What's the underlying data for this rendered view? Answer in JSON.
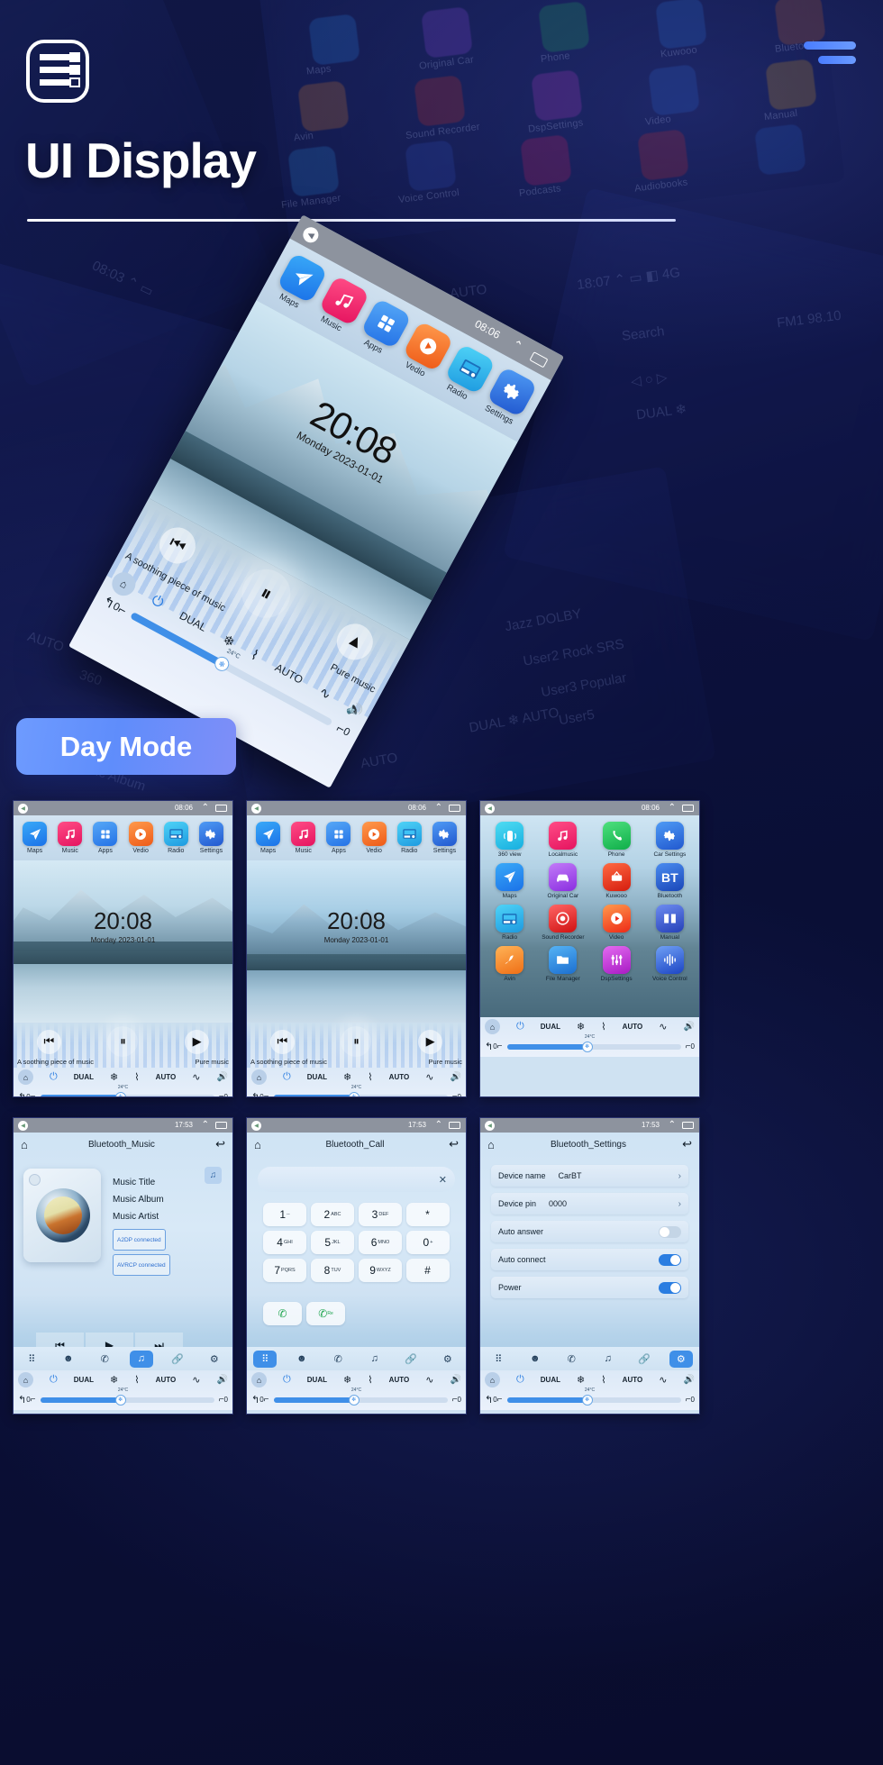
{
  "header": {
    "title": "UI Display",
    "logo_icon": "list-logo-icon",
    "menu_icon": "hamburger-menu-icon"
  },
  "badge": {
    "label": "Day Mode"
  },
  "hero": {
    "status": {
      "time": "08:06",
      "back_icon": "back-circle-icon",
      "chevron_icon": "chevron-up-icon",
      "window_icon": "recent-apps-icon"
    },
    "dock": [
      {
        "label": "Maps",
        "icon": "navigation-icon",
        "color": "#2b8cf5"
      },
      {
        "label": "Music",
        "icon": "music-note-icon",
        "color": "#f0316d"
      },
      {
        "label": "Apps",
        "icon": "grid-icon",
        "color": "#3b8ef0"
      },
      {
        "label": "Vedio",
        "icon": "play-icon",
        "color": "#f2702a"
      },
      {
        "label": "Radio",
        "icon": "radio-icon",
        "color": "#2fb3ef"
      },
      {
        "label": "Settings",
        "icon": "gear-icon",
        "color": "#2d7bea"
      }
    ],
    "clock": "20:08",
    "date": "Monday  2023-01-01",
    "media": {
      "song": "A soothing piece of music",
      "mode": "Pure music",
      "prev_icon": "prev-track-icon",
      "pause_icon": "pause-icon",
      "next_icon": "next-track-icon"
    },
    "climate": {
      "home_icon": "home-icon",
      "power_icon": "power-icon",
      "dual": "DUAL",
      "snow_icon": "snowflake-icon",
      "temp": "24°C",
      "defrost_icon": "rear-defrost-icon",
      "auto": "AUTO",
      "wave_icon": "airflow-icon",
      "volume_icon": "volume-icon",
      "back_icon": "back-arrow-icon",
      "left_value": "0",
      "right_value": "0",
      "seat_icon": "seat-icon",
      "fan_icon": "fan-icon"
    }
  },
  "thumbnails": [
    {
      "name": "home-winter-lake",
      "type": "home",
      "status": {
        "time": "08:06"
      },
      "dock": [
        {
          "label": "Maps",
          "icon": "navigation-icon",
          "color": "#2b8cf5"
        },
        {
          "label": "Music",
          "icon": "music-note-icon",
          "color": "#f0316d"
        },
        {
          "label": "Apps",
          "icon": "grid-icon",
          "color": "#3b8ef0"
        },
        {
          "label": "Vedio",
          "icon": "play-icon",
          "color": "#f2702a"
        },
        {
          "label": "Radio",
          "icon": "radio-icon",
          "color": "#2fb3ef"
        },
        {
          "label": "Settings",
          "icon": "gear-icon",
          "color": "#2d7bea"
        }
      ],
      "clock": "20:08",
      "date": "Monday  2023-01-01",
      "song": "A soothing piece of music",
      "mode": "Pure music"
    },
    {
      "name": "home-mountain-lake",
      "type": "home",
      "status": {
        "time": "08:06"
      },
      "dock": [
        {
          "label": "Maps",
          "icon": "navigation-icon",
          "color": "#2b8cf5"
        },
        {
          "label": "Music",
          "icon": "music-note-icon",
          "color": "#f0316d"
        },
        {
          "label": "Apps",
          "icon": "grid-icon",
          "color": "#3b8ef0"
        },
        {
          "label": "Vedio",
          "icon": "play-icon",
          "color": "#f2702a"
        },
        {
          "label": "Radio",
          "icon": "radio-icon",
          "color": "#2fb3ef"
        },
        {
          "label": "Settings",
          "icon": "gear-icon",
          "color": "#2d7bea"
        }
      ],
      "clock": "20:08",
      "date": "Monday  2023-01-01",
      "song": "A soothing piece of music",
      "mode": "Pure music"
    },
    {
      "name": "apps-grid",
      "type": "apps",
      "status": {
        "time": "08:06"
      },
      "apps": [
        {
          "label": "360 view",
          "icon": "car-360-icon",
          "color": "#25c3e8"
        },
        {
          "label": "Localmusic",
          "icon": "music-note-icon",
          "color": "#f0316d"
        },
        {
          "label": "Phone",
          "icon": "phone-icon",
          "color": "#1fc45e"
        },
        {
          "label": "Car Settings",
          "icon": "gear-icon",
          "color": "#2d7bea"
        },
        {
          "label": "Maps",
          "icon": "navigation-icon",
          "color": "#2b8cf5"
        },
        {
          "label": "Original Car",
          "icon": "original-car-icon",
          "color": "#9b4df0"
        },
        {
          "label": "Kuwooo",
          "icon": "kuwo-icon",
          "color": "#e8321f"
        },
        {
          "label": "Bluetooth",
          "icon": "bluetooth-icon",
          "color": "#2563cf"
        },
        {
          "label": "Radio",
          "icon": "radio-icon",
          "color": "#2fb3ef"
        },
        {
          "label": "Sound Recorder",
          "icon": "record-icon",
          "color": "#e02b2b"
        },
        {
          "label": "Video",
          "icon": "play-icon",
          "color": "#f2702a"
        },
        {
          "label": "Manual",
          "icon": "book-icon",
          "color": "#3355c8"
        },
        {
          "label": "Avin",
          "icon": "avin-icon",
          "color": "#f58b2a"
        },
        {
          "label": "File Manager",
          "icon": "folder-icon",
          "color": "#2f93e8"
        },
        {
          "label": "DspSettings",
          "icon": "equalizer-icon",
          "color": "#c93fd6"
        },
        {
          "label": "Voice Control",
          "icon": "voice-wave-icon",
          "color": "#2f6fe0"
        }
      ]
    },
    {
      "name": "bluetooth-music",
      "type": "bt_music",
      "status": {
        "time": "17:53"
      },
      "title": "Bluetooth_Music",
      "home_icon": "home-icon",
      "back_icon": "return-icon",
      "note_icon": "music-note-icon",
      "meta": [
        "Music Title",
        "Music Album",
        "Music Artist"
      ],
      "tags": [
        "A2DP  connected",
        "AVRCP connected"
      ],
      "controls": [
        "prev-track-icon",
        "play-icon",
        "next-track-icon"
      ],
      "tabs": [
        "keypad-icon",
        "contacts-icon",
        "phone-icon",
        "music-note-icon",
        "link-icon",
        "gear-icon"
      ],
      "active_tab": 3
    },
    {
      "name": "bluetooth-call",
      "type": "bt_call",
      "status": {
        "time": "17:53"
      },
      "title": "Bluetooth_Call",
      "home_icon": "home-icon",
      "back_icon": "return-icon",
      "dial_value": "",
      "clear_icon": "clear-x-icon",
      "keys": [
        {
          "d": "1",
          "s": "--"
        },
        {
          "d": "2",
          "s": "ABC"
        },
        {
          "d": "3",
          "s": "DEF"
        },
        {
          "d": "*",
          "s": ""
        },
        {
          "d": "4",
          "s": "GHI"
        },
        {
          "d": "5",
          "s": "JKL"
        },
        {
          "d": "6",
          "s": "MNO"
        },
        {
          "d": "0",
          "s": "+"
        },
        {
          "d": "7",
          "s": "PQRS"
        },
        {
          "d": "8",
          "s": "TUV"
        },
        {
          "d": "9",
          "s": "WXYZ"
        },
        {
          "d": "#",
          "s": ""
        }
      ],
      "call_buttons": [
        "call-icon",
        "redial-icon"
      ],
      "tabs": [
        "keypad-icon",
        "contacts-icon",
        "phone-icon",
        "music-note-icon",
        "link-icon",
        "gear-icon"
      ],
      "active_tab": 0
    },
    {
      "name": "bluetooth-settings",
      "type": "bt_settings",
      "status": {
        "time": "17:53"
      },
      "title": "Bluetooth_Settings",
      "home_icon": "home-icon",
      "back_icon": "return-icon",
      "rows": [
        {
          "label": "Device name",
          "value": "CarBT",
          "control": "chevron"
        },
        {
          "label": "Device pin",
          "value": "0000",
          "control": "chevron"
        },
        {
          "label": "Auto answer",
          "value": "",
          "control": "toggle-off"
        },
        {
          "label": "Auto connect",
          "value": "",
          "control": "toggle-on"
        },
        {
          "label": "Power",
          "value": "",
          "control": "toggle-on"
        }
      ],
      "tabs": [
        "keypad-icon",
        "contacts-icon",
        "phone-icon",
        "music-note-icon",
        "link-icon",
        "gear-icon"
      ],
      "active_tab": 5
    }
  ],
  "climate_bar": {
    "home_icon": "home-icon",
    "power_icon": "power-icon",
    "dual": "DUAL",
    "snow_icon": "snowflake-icon",
    "temp": "24°C",
    "defrost_icon": "rear-defrost-icon",
    "auto": "AUTO",
    "airflow_icon": "airflow-icon",
    "volume_icon": "volume-icon",
    "back_icon": "back-arrow-icon",
    "left_value": "0",
    "right_value": "0",
    "seat_left_icon": "seat-heat-left-icon",
    "seat_right_icon": "seat-heat-right-icon",
    "fan_icon": "fan-icon"
  },
  "background_labels": [
    "Maps",
    "Phone",
    "Original Car",
    "Radio",
    "Kuwooo",
    "Sound Recorder",
    "Bluetooth",
    "Avin",
    "Video",
    "File Manager",
    "Manual",
    "DspSettings",
    "Voice Control",
    "DUAL",
    "AUTO",
    "360",
    "08:03",
    "18:07",
    "Search",
    "Music Title",
    "Music Album",
    "Jazz",
    "Rock",
    "User2",
    "User3",
    "User5",
    "Popular",
    "DOLBY",
    "SRS"
  ],
  "colors": {
    "page_bg": "#0a0e33",
    "accent": "#5f8dfb",
    "badge_from": "#6e9bff",
    "badge_to": "#7f8ef8",
    "status_bar": "#8d939e"
  }
}
